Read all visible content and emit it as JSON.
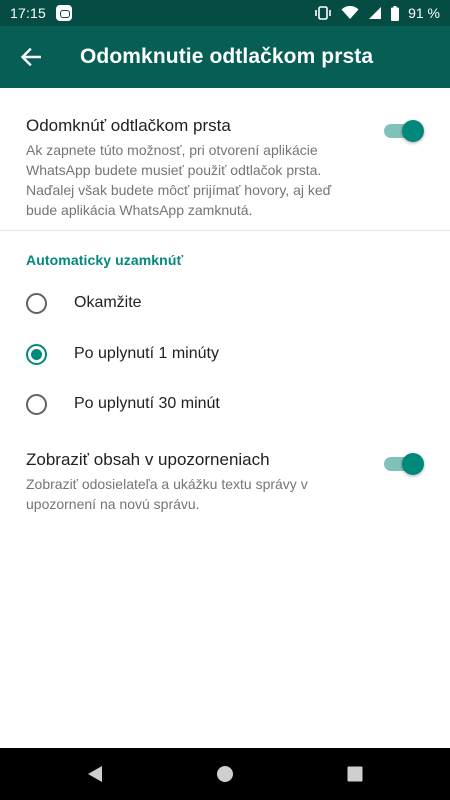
{
  "status_bar": {
    "time": "17:15",
    "battery": "91 %",
    "icons": [
      "whatsapp-notification-icon",
      "vibrate-icon",
      "wifi-icon",
      "signal-icon",
      "battery-icon"
    ]
  },
  "app_bar": {
    "title": "Odomknutie odtlačkom prsta",
    "back_icon": "arrow-left-icon",
    "color": "#075e54"
  },
  "fingerprint_setting": {
    "title": "Odomknúť odtlačkom prsta",
    "description": "Ak zapnete túto možnosť, pri otvorení aplikácie WhatsApp budete musieť použiť odtlačok prsta. Naďalej však budete môcť prijímať hovory, aj keď bude aplikácia WhatsApp zamknutá.",
    "enabled": true
  },
  "auto_lock": {
    "header": "Automaticky uzamknúť",
    "options": [
      {
        "label": "Okamžite",
        "selected": false
      },
      {
        "label": "Po uplynutí 1 minúty",
        "selected": true
      },
      {
        "label": "Po uplynutí 30 minút",
        "selected": false
      }
    ]
  },
  "notification_setting": {
    "title": "Zobraziť obsah v upozorneniach",
    "description": "Zobraziť odosielateľa a ukážku textu správy v upozornení na novú správu.",
    "enabled": true
  },
  "accent_color": "#00897b",
  "nav_bar": {
    "icons": [
      "back-triangle-icon",
      "home-circle-icon",
      "recents-square-icon"
    ]
  }
}
